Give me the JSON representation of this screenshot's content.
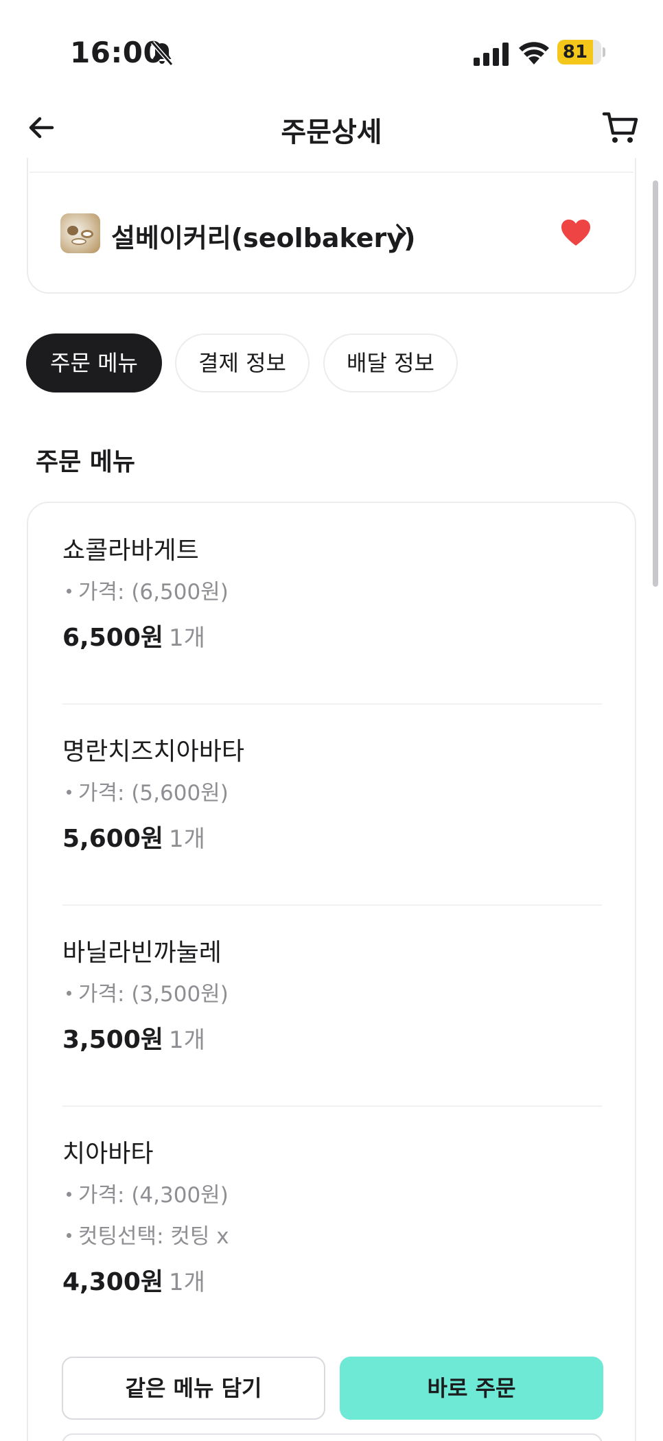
{
  "status_bar": {
    "time": "16:00",
    "icons": [
      "bell-slash-icon",
      "cellular-signal-icon",
      "wifi-icon",
      "battery-icon"
    ],
    "battery_level": "81",
    "battery_fraction": 0.81,
    "battery_color": "#f5c71a"
  },
  "nav": {
    "title": "주문상세",
    "back_icon": "arrow-left-icon",
    "cart_icon": "cart-icon"
  },
  "store": {
    "name": "설베이커리(seolbakery)",
    "chevron_icon": "chevron-right-icon",
    "favorite_icon": "heart-icon",
    "favorite_color": "#ef4444"
  },
  "tabs": [
    {
      "label": "주문 메뉴",
      "active": true
    },
    {
      "label": "결제 정보",
      "active": false
    },
    {
      "label": "배달 정보",
      "active": false
    }
  ],
  "section_title": "주문 메뉴",
  "items": [
    {
      "name": "쇼콜라바게트",
      "options": [
        "가격:  (6,500원)"
      ],
      "price": "6,500원",
      "qty": "1개"
    },
    {
      "name": "명란치즈치아바타",
      "options": [
        "가격:  (5,600원)"
      ],
      "price": "5,600원",
      "qty": "1개"
    },
    {
      "name": "바닐라빈까눌레",
      "options": [
        "가격:  (3,500원)"
      ],
      "price": "3,500원",
      "qty": "1개"
    },
    {
      "name": "치아바타",
      "options": [
        "가격:  (4,300원)",
        "컷팅선택: 컷팅 x"
      ],
      "price": "4,300원",
      "qty": "1개"
    }
  ],
  "buttons": {
    "add_same": "같은 메뉴 담기",
    "order_now": "바로 주문"
  },
  "colors": {
    "accent": "#6ee9d6",
    "active_tab": "#1c1c1e"
  }
}
